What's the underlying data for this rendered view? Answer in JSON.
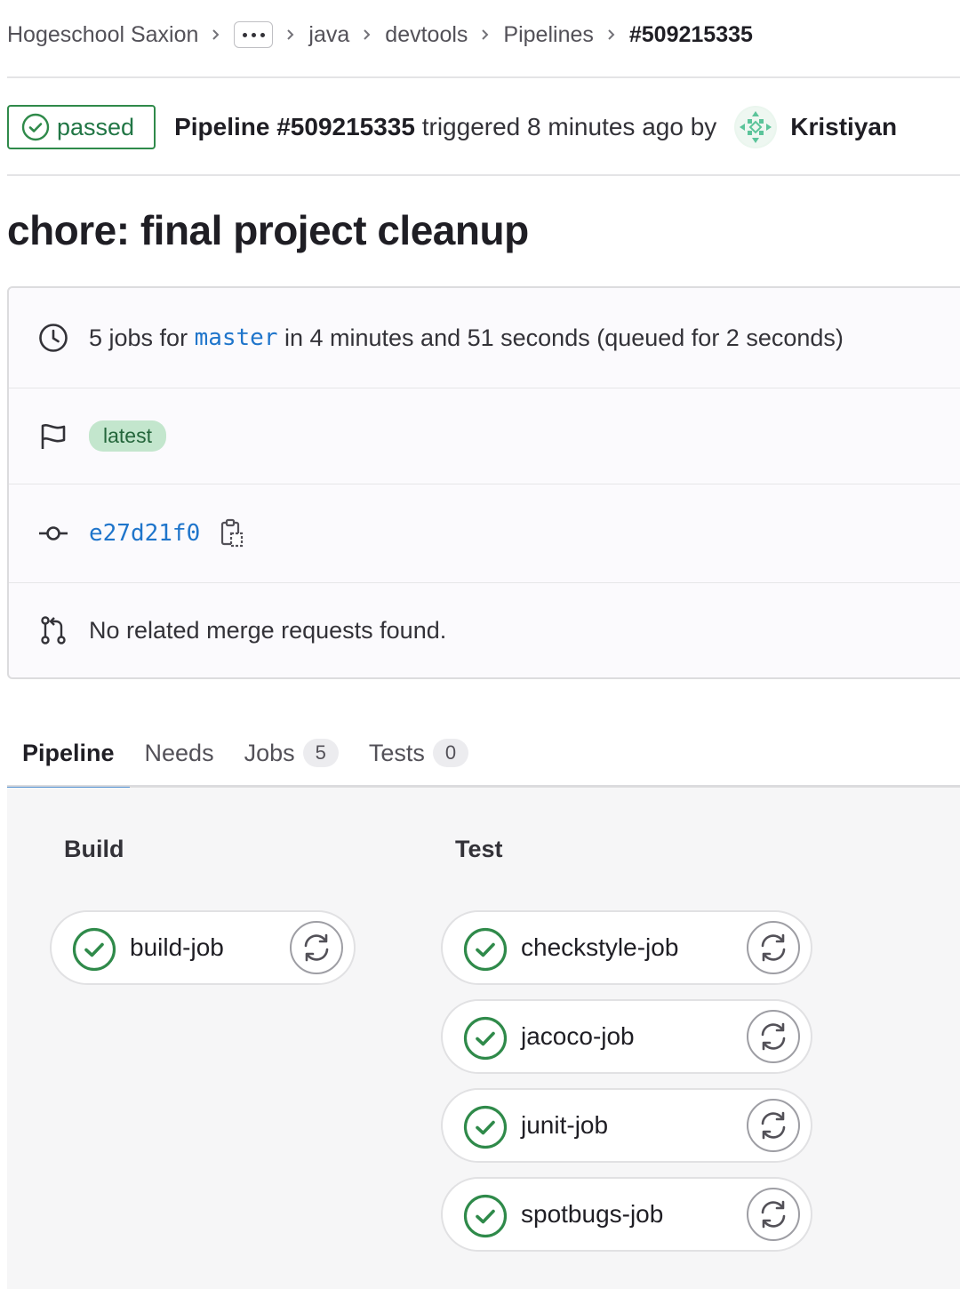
{
  "breadcrumb": {
    "group": "Hogeschool Saxion",
    "items": [
      "java",
      "devtools",
      "Pipelines"
    ],
    "current": "#509215335"
  },
  "header": {
    "status": "passed",
    "pipeline_label": "Pipeline #509215335",
    "triggered_text": " triggered 8 minutes ago by",
    "author": "Kristiyan"
  },
  "commit": {
    "title": "chore: final project cleanup"
  },
  "info": {
    "jobs_prefix": "5 jobs for ",
    "branch": "master",
    "jobs_suffix": " in 4 minutes and 51 seconds (queued for 2 seconds)",
    "label": "latest",
    "sha": "e27d21f0",
    "merge_requests": "No related merge requests found."
  },
  "tabs": [
    {
      "label": "Pipeline"
    },
    {
      "label": "Needs"
    },
    {
      "label": "Jobs",
      "count": "5"
    },
    {
      "label": "Tests",
      "count": "0"
    }
  ],
  "stages": [
    {
      "title": "Build",
      "jobs": [
        "build-job"
      ]
    },
    {
      "title": "Test",
      "jobs": [
        "checkstyle-job",
        "jacoco-job",
        "junit-job",
        "spotbugs-job"
      ]
    }
  ],
  "colors": {
    "success": "#2f8a4a",
    "link": "#1f75cb",
    "label_bg": "#c3e6cd"
  },
  "icons": {
    "status": "check-circle-icon",
    "retry": "retry-icon",
    "duration": "clock-icon",
    "labels": "flag-icon",
    "commit": "commit-icon",
    "merge_request": "merge-request-icon",
    "copy": "copy-icon"
  }
}
